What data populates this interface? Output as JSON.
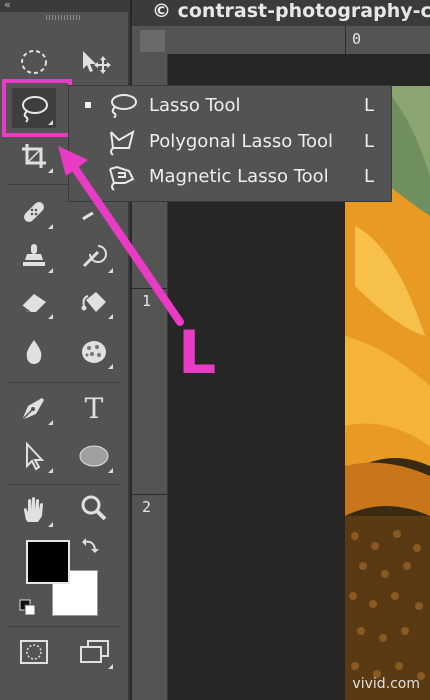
{
  "window": {
    "collapse_glyph": "«",
    "document_tab_title": "© contrast-photography-cl"
  },
  "rulers": {
    "top_label_0": "0",
    "left_label_1": "1",
    "left_label_2": "2"
  },
  "toolbox": {
    "tools": [
      {
        "name": "marquee-tool",
        "icon": "dashed-ellipse-icon"
      },
      {
        "name": "move-tool",
        "icon": "move-arrow-icon"
      },
      {
        "name": "lasso-tool",
        "icon": "lasso-icon",
        "selected": true
      },
      {
        "name": "quick-selection-tool",
        "icon": "magic-wand-icon"
      },
      {
        "name": "crop-tool",
        "icon": "crop-icon"
      },
      {
        "name": "eyedropper-tool",
        "icon": "eyedropper-icon"
      },
      {
        "name": "healing-brush-tool",
        "icon": "bandage-icon"
      },
      {
        "name": "brush-tool",
        "icon": "brush-icon"
      },
      {
        "name": "clone-stamp-tool",
        "icon": "stamp-icon"
      },
      {
        "name": "history-brush-tool",
        "icon": "history-brush-icon"
      },
      {
        "name": "eraser-tool",
        "icon": "eraser-icon"
      },
      {
        "name": "paint-bucket-tool",
        "icon": "paint-bucket-icon"
      },
      {
        "name": "blur-tool",
        "icon": "drop-icon"
      },
      {
        "name": "sponge-tool",
        "icon": "sponge-icon"
      },
      {
        "name": "pen-tool",
        "icon": "pen-icon"
      },
      {
        "name": "type-tool",
        "icon": "type-icon",
        "glyph": "T"
      },
      {
        "name": "path-selection-tool",
        "icon": "arrow-cursor-icon"
      },
      {
        "name": "ellipse-tool",
        "icon": "ellipse-shape-icon"
      },
      {
        "name": "hand-tool",
        "icon": "hand-icon"
      },
      {
        "name": "zoom-tool",
        "icon": "magnifier-icon"
      }
    ],
    "foreground_color": "#000000",
    "background_color": "#ffffff"
  },
  "flyout": {
    "items": [
      {
        "label": "Lasso Tool",
        "shortcut": "L",
        "icon": "lasso-icon",
        "active": true
      },
      {
        "label": "Polygonal Lasso Tool",
        "shortcut": "L",
        "icon": "polygonal-lasso-icon",
        "active": false
      },
      {
        "label": "Magnetic Lasso Tool",
        "shortcut": "L",
        "icon": "magnetic-lasso-icon",
        "active": false
      }
    ]
  },
  "annotation": {
    "shortcut_letter": "L",
    "highlight_color": "#e83cc4"
  },
  "watermark": "vivid.com"
}
